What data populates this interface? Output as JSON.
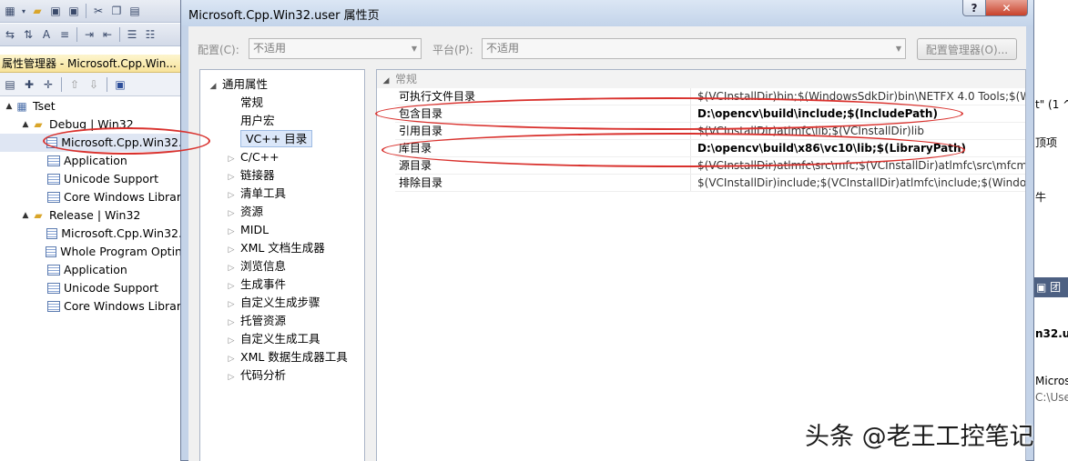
{
  "background_ide": {
    "property_manager_title": "属性管理器 - Microsoft.Cpp.Win...",
    "tree": [
      {
        "label": "Tset",
        "icon": "project-icon",
        "level": 0,
        "arrow": "▲"
      },
      {
        "label": "Debug | Win32",
        "icon": "folder-icon",
        "level": 1,
        "arrow": "▲"
      },
      {
        "label": "Microsoft.Cpp.Win32.",
        "icon": "property-sheet-icon",
        "level": 2,
        "arrow": "",
        "selected": true
      },
      {
        "label": "Application",
        "icon": "property-sheet-icon",
        "level": 2,
        "arrow": ""
      },
      {
        "label": "Unicode Support",
        "icon": "property-sheet-icon",
        "level": 2,
        "arrow": ""
      },
      {
        "label": "Core Windows Librar",
        "icon": "property-sheet-icon",
        "level": 2,
        "arrow": ""
      },
      {
        "label": "Release | Win32",
        "icon": "folder-icon",
        "level": 1,
        "arrow": "▲"
      },
      {
        "label": "Microsoft.Cpp.Win32.",
        "icon": "property-sheet-icon",
        "level": 2,
        "arrow": ""
      },
      {
        "label": "Whole Program Optin",
        "icon": "property-sheet-icon",
        "level": 2,
        "arrow": ""
      },
      {
        "label": "Application",
        "icon": "property-sheet-icon",
        "level": 2,
        "arrow": ""
      },
      {
        "label": "Unicode Support",
        "icon": "property-sheet-icon",
        "level": 2,
        "arrow": ""
      },
      {
        "label": "Core Windows Librar",
        "icon": "property-sheet-icon",
        "level": 2,
        "arrow": ""
      }
    ],
    "right_fragments": {
      "quote_text": "t\" (1 ^",
      "option_text": "顶项",
      "piece_text": "牛",
      "tab_header": "团",
      "file_label": "n32.us",
      "bottom_name": "Micros",
      "bottom_path": "C:\\Use"
    }
  },
  "dialog": {
    "title": "Microsoft.Cpp.Win32.user 属性页",
    "help_label": "?",
    "close_label": "✕",
    "config_label": "配置(C):",
    "config_value": "不适用",
    "platform_label": "平台(P):",
    "platform_value": "不适用",
    "config_manager_label": "配置管理器(O)...",
    "left_tree": [
      {
        "label": "通用属性",
        "arrow": "◢",
        "level": 0
      },
      {
        "label": "常规",
        "arrow": "",
        "level": 1
      },
      {
        "label": "用户宏",
        "arrow": "",
        "level": 1
      },
      {
        "label": "VC++ 目录",
        "arrow": "",
        "level": 1,
        "selected": true
      },
      {
        "label": "C/C++",
        "arrow": "▷",
        "level": 1
      },
      {
        "label": "链接器",
        "arrow": "▷",
        "level": 1
      },
      {
        "label": "清单工具",
        "arrow": "▷",
        "level": 1
      },
      {
        "label": "资源",
        "arrow": "▷",
        "level": 1
      },
      {
        "label": "MIDL",
        "arrow": "▷",
        "level": 1
      },
      {
        "label": "XML 文档生成器",
        "arrow": "▷",
        "level": 1
      },
      {
        "label": "浏览信息",
        "arrow": "▷",
        "level": 1
      },
      {
        "label": "生成事件",
        "arrow": "▷",
        "level": 1
      },
      {
        "label": "自定义生成步骤",
        "arrow": "▷",
        "level": 1
      },
      {
        "label": "托管资源",
        "arrow": "▷",
        "level": 1
      },
      {
        "label": "自定义生成工具",
        "arrow": "▷",
        "level": 1
      },
      {
        "label": "XML 数据生成器工具",
        "arrow": "▷",
        "level": 1
      },
      {
        "label": "代码分析",
        "arrow": "▷",
        "level": 1
      }
    ],
    "category": "常规",
    "properties": [
      {
        "name": "可执行文件目录",
        "value": "$(VCInstallDir)bin;$(WindowsSdkDir)bin\\NETFX 4.0 Tools;$(Wi",
        "bold": false
      },
      {
        "name": "包含目录",
        "value": "D:\\opencv\\build\\include;$(IncludePath)",
        "bold": true
      },
      {
        "name": "引用目录",
        "value": "$(VCInstallDir)atlmfc\\lib;$(VCInstallDir)lib",
        "bold": false
      },
      {
        "name": "库目录",
        "value": "D:\\opencv\\build\\x86\\vc10\\lib;$(LibraryPath)",
        "bold": true
      },
      {
        "name": "源目录",
        "value": "$(VCInstallDir)atlmfc\\src\\mfc;$(VCInstallDir)atlmfc\\src\\mfcm;$(",
        "bold": false
      },
      {
        "name": "排除目录",
        "value": "$(VCInstallDir)include;$(VCInstallDir)atlmfc\\include;$(WindowsS",
        "bold": false
      }
    ]
  },
  "watermark": "头条 @老王工控笔记",
  "colors": {
    "annotation_red": "#d9312d",
    "dialog_frame": "#c4d3e8",
    "selection": "#dbe7f9"
  }
}
